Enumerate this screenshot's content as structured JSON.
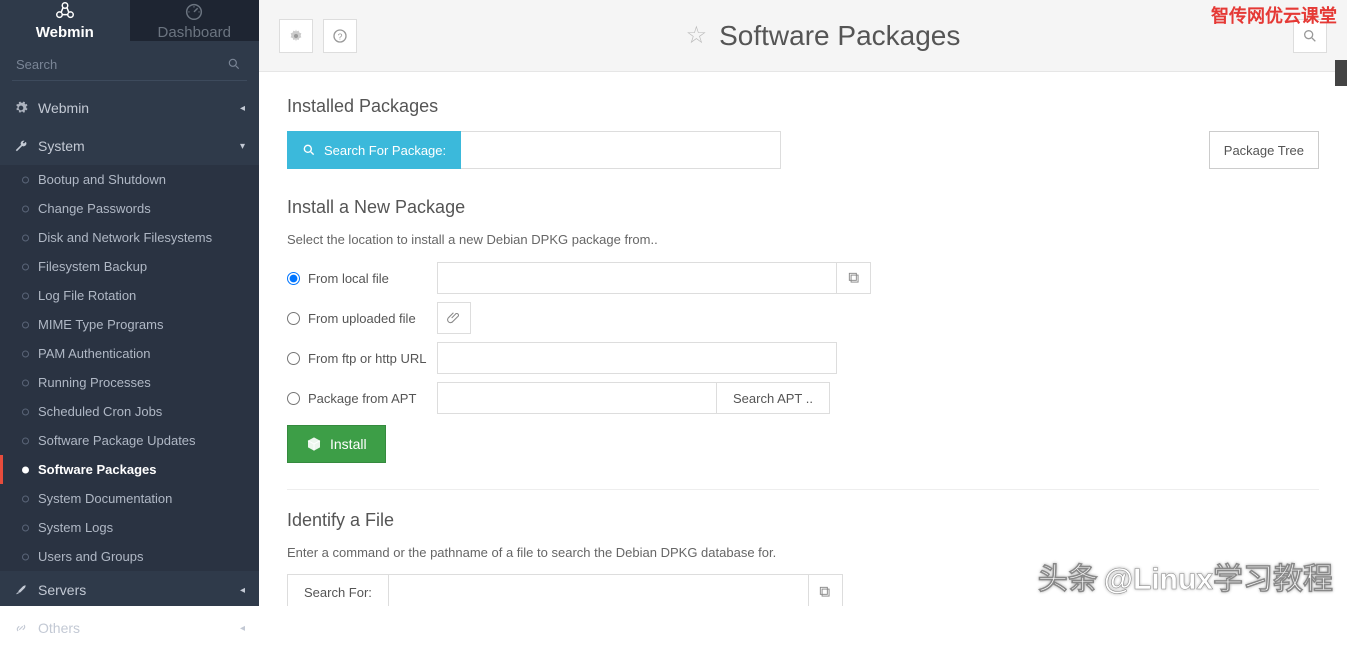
{
  "sidebar": {
    "tabs": {
      "webmin": "Webmin",
      "dashboard": "Dashboard"
    },
    "search_placeholder": "Search",
    "cats": {
      "webmin": "Webmin",
      "system": "System",
      "servers": "Servers",
      "others": "Others"
    },
    "system_items": [
      "Bootup and Shutdown",
      "Change Passwords",
      "Disk and Network Filesystems",
      "Filesystem Backup",
      "Log File Rotation",
      "MIME Type Programs",
      "PAM Authentication",
      "Running Processes",
      "Scheduled Cron Jobs",
      "Software Package Updates",
      "Software Packages",
      "System Documentation",
      "System Logs",
      "Users and Groups"
    ],
    "active_index": 10
  },
  "page": {
    "title": "Software Packages",
    "installed_h": "Installed Packages",
    "search_btn": "Search For Package:",
    "package_tree": "Package Tree",
    "install_h": "Install a New Package",
    "install_help": "Select the location to install a new Debian DPKG package from..",
    "opts": {
      "local": "From local file",
      "upload": "From uploaded file",
      "url": "From ftp or http URL",
      "apt": "Package from APT"
    },
    "search_apt": "Search APT ..",
    "install_btn": "Install",
    "identify_h": "Identify a File",
    "identify_help": "Enter a command or the pathname of a file to search the Debian DPKG database for.",
    "search_for": "Search For:"
  },
  "watermarks": {
    "top": "智传网优云课堂",
    "bottom_a": "头条",
    "bottom_b": "@Linux学习教程"
  }
}
